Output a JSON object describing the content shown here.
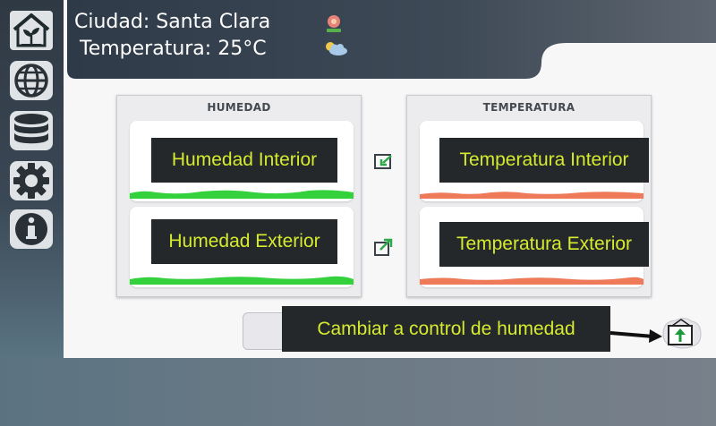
{
  "header": {
    "city_label": "Ciudad: Santa Clara",
    "temp_label": "Temperatura: 25°C",
    "city_icon": "flower-icon",
    "weather_icon": "cloud-icon"
  },
  "sidebar": {
    "items": [
      {
        "icon": "greenhouse-icon"
      },
      {
        "icon": "globe-icon"
      },
      {
        "icon": "database-icon"
      },
      {
        "icon": "gear-icon"
      },
      {
        "icon": "info-icon"
      }
    ]
  },
  "panels": {
    "humidity": {
      "title": "HUMEDAD",
      "interior_label": "Humedad Interior",
      "exterior_label": "Humedad Exterior"
    },
    "temperature": {
      "title": "TEMPERATURA",
      "interior_label": "Temperatura Interior",
      "exterior_label": "Temperatura Exterior"
    }
  },
  "footer": {
    "switch_tooltip": "Cambiar a control de humedad"
  },
  "colors": {
    "accent_text": "#d6ea2e",
    "humidity_wave": "#33d13b",
    "temperature_wave": "#ee7a5a",
    "sidebar": "#2f3944"
  }
}
